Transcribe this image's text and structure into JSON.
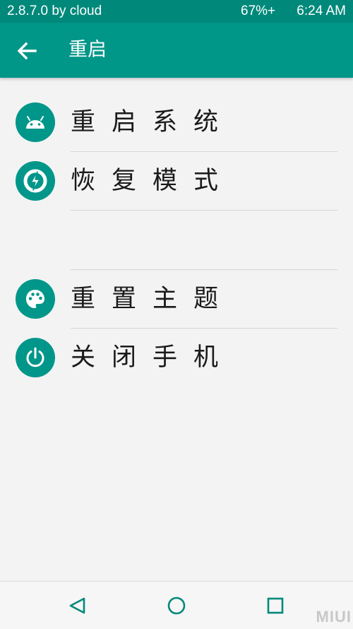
{
  "status_bar": {
    "left_text": "2.8.7.0 by cloud",
    "battery": "67%+",
    "time": "6:24 AM"
  },
  "app_bar": {
    "back_icon": "arrow-left-icon",
    "title": "重启"
  },
  "menu": {
    "items": [
      {
        "label": "重启系统",
        "icon": "android-icon"
      },
      {
        "label": "恢复模式",
        "icon": "twrp-recovery-icon"
      },
      {
        "label": "重置主题",
        "icon": "palette-icon"
      },
      {
        "label": "关闭手机",
        "icon": "power-icon"
      }
    ]
  },
  "nav_bar": {
    "back_icon": "triangle-back-icon",
    "home_icon": "circle-home-icon",
    "recents_icon": "square-recents-icon"
  },
  "watermark": "MIUI",
  "colors": {
    "status_bar": "#00897b",
    "app_bar": "#009688",
    "icon_circle": "#00968a",
    "background": "#f3f3f3",
    "nav_icon": "#00897b"
  }
}
